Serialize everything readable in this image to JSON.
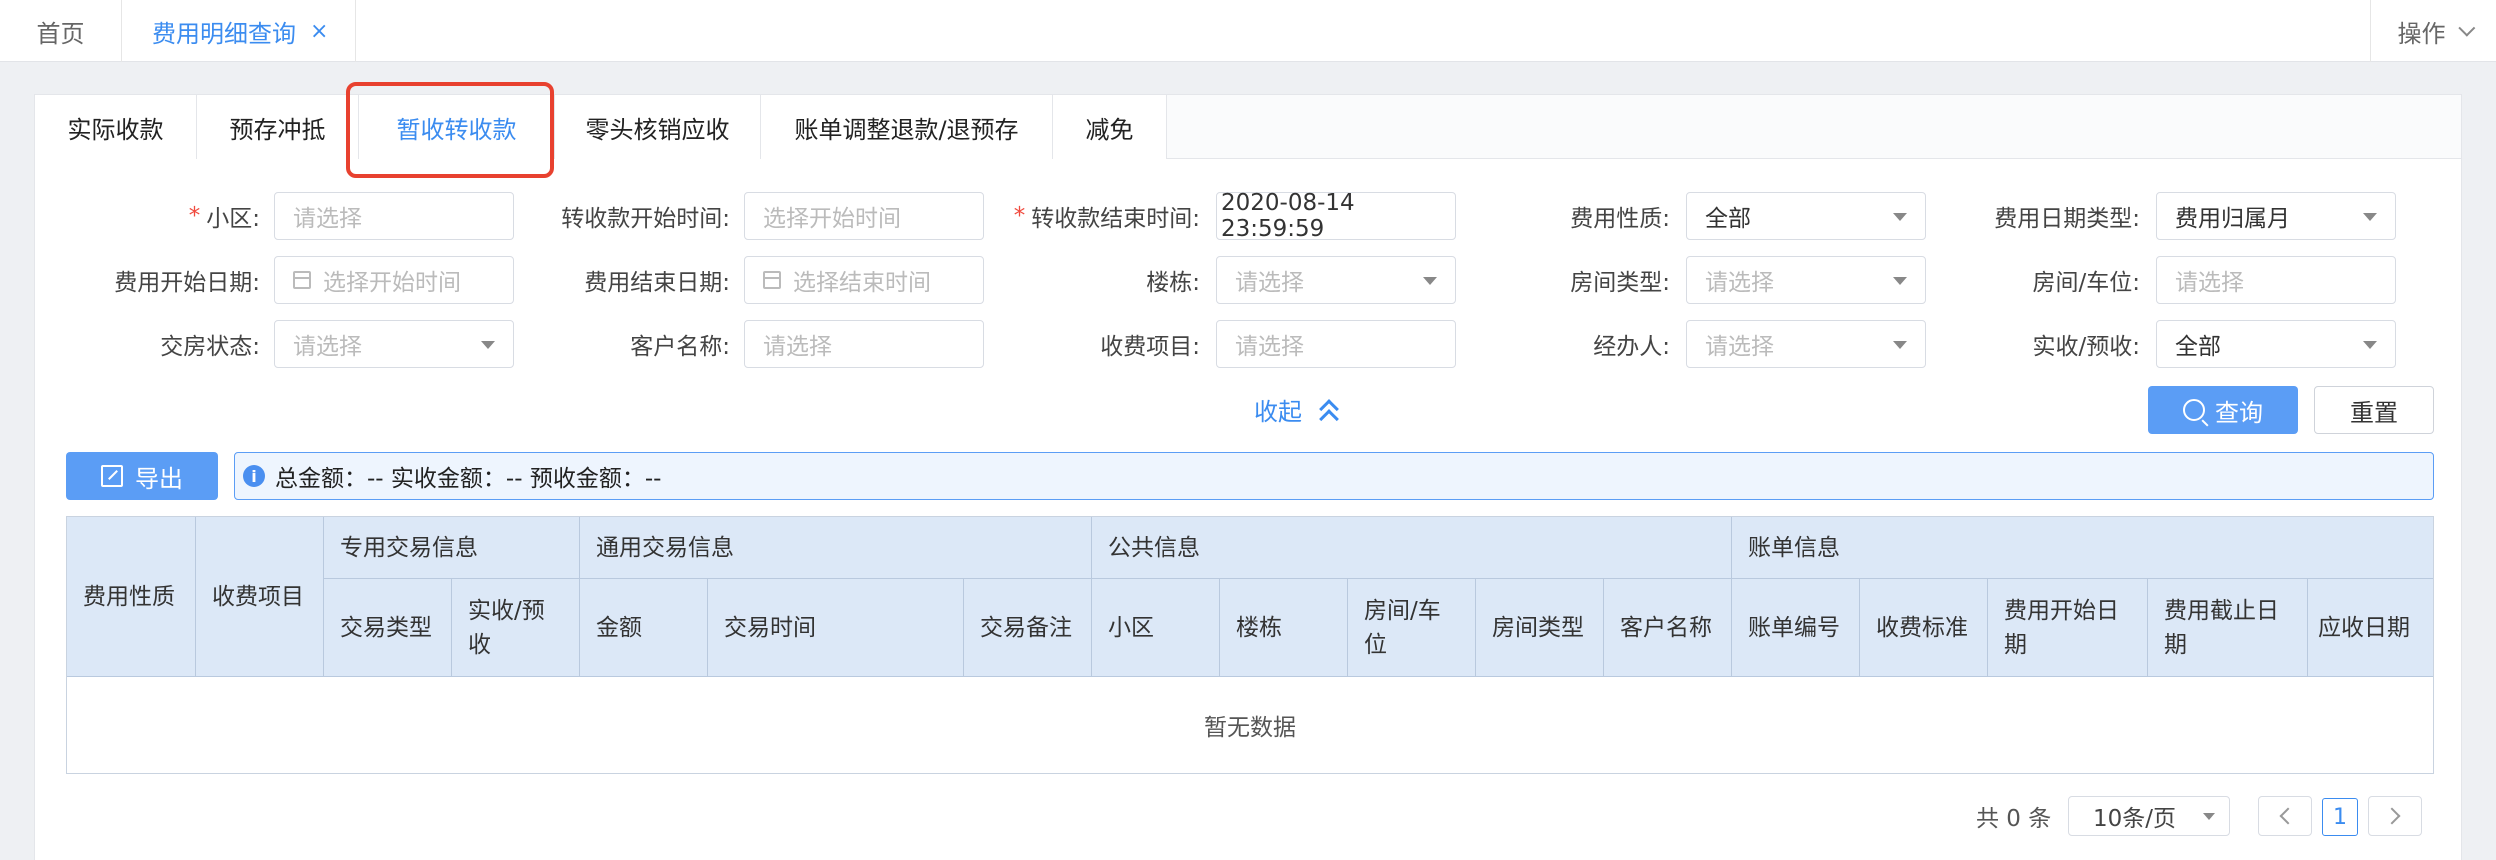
{
  "top_tabs": {
    "home": "首页",
    "active": "费用明细查询",
    "close": "×",
    "ops": "操作"
  },
  "sub_tabs": [
    "实际收款",
    "预存冲抵",
    "暂收转收款",
    "零头核销应收",
    "账单调整退款/退预存",
    "减免"
  ],
  "filters": {
    "community_label": "小区:",
    "community_placeholder": "请选择",
    "transfer_start_label": "转收款开始时间:",
    "transfer_start_placeholder": "选择开始时间",
    "transfer_end_label": "转收款结束时间:",
    "transfer_end_value": "2020-08-14 23:59:59",
    "fee_nature_label": "费用性质:",
    "fee_nature_value": "全部",
    "fee_date_type_label": "费用日期类型:",
    "fee_date_type_value": "费用归属月",
    "fee_start_label": "费用开始日期:",
    "fee_start_placeholder": "选择开始时间",
    "fee_end_label": "费用结束日期:",
    "fee_end_placeholder": "选择结束时间",
    "building_label": "楼栋:",
    "building_placeholder": "请选择",
    "room_type_label": "房间类型:",
    "room_type_placeholder": "请选择",
    "room_label": "房间/车位:",
    "room_placeholder": "请选择",
    "handover_label": "交房状态:",
    "handover_placeholder": "请选择",
    "customer_label": "客户名称:",
    "customer_placeholder": "请选择",
    "charge_item_label": "收费项目:",
    "charge_item_placeholder": "请选择",
    "handler_label": "经办人:",
    "handler_placeholder": "请选择",
    "received_label": "实收/预收:",
    "received_value": "全部"
  },
  "actions": {
    "collapse": "收起",
    "query": "查询",
    "reset": "重置",
    "export": "导出"
  },
  "summary": {
    "info": "i",
    "text": "总金额：-- 实收金额：-- 预收金额：--"
  },
  "table": {
    "groups": [
      "专用交易信息",
      "通用交易信息",
      "公共信息",
      "账单信息"
    ],
    "col_fee_nature": "费用性质",
    "col_charge_item": "收费项目",
    "col_trade_type": "交易类型",
    "col_received": "实收/预收",
    "col_amount": "金额",
    "col_trade_time": "交易时间",
    "col_trade_note": "交易备注",
    "col_community": "小区",
    "col_building": "楼栋",
    "col_room": "房间/车位",
    "col_room_type": "房间类型",
    "col_customer": "客户名称",
    "col_bill_no": "账单编号",
    "col_standard": "收费标准",
    "col_fee_start": "费用开始日期",
    "col_fee_end": "费用截止日期",
    "col_due_date": "应收日期",
    "empty": "暂无数据"
  },
  "pager": {
    "total": "共 0 条",
    "size": "10条/页",
    "page": "1"
  },
  "colors": {
    "accent": "#3b8cf0",
    "button": "#5b9df5",
    "header_bg": "#dce8f7",
    "highlight": "#e8412f"
  }
}
